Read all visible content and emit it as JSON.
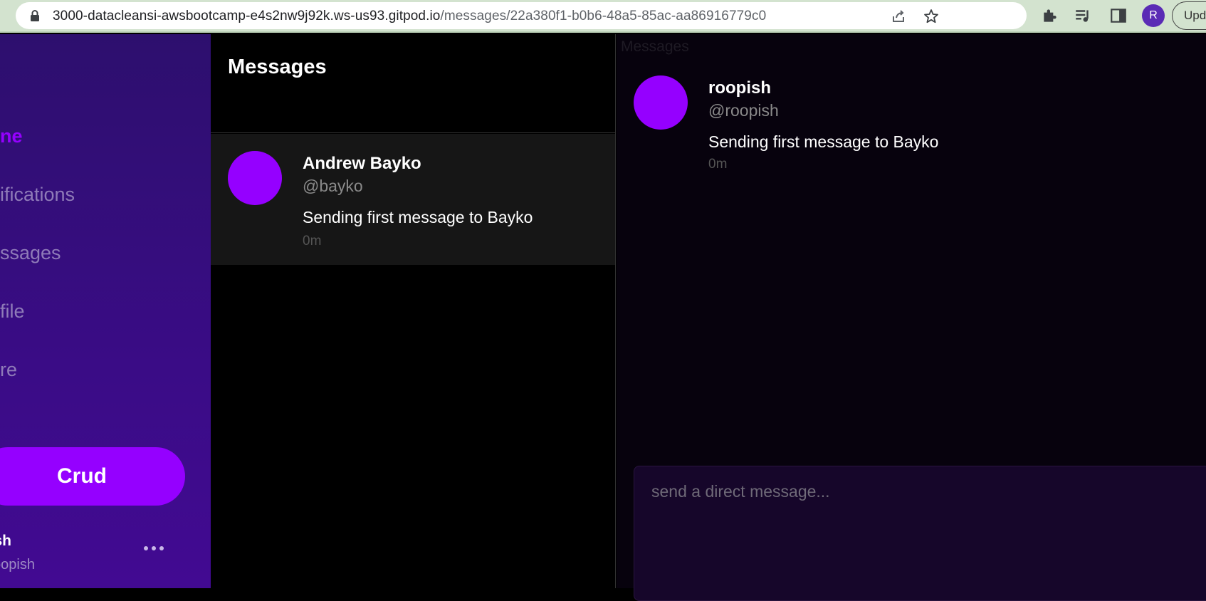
{
  "browser": {
    "url_host": "3000-datacleansi-awsbootcamp-e4s2nw9j92k.ws-us93.gitpod.io",
    "url_path": "/messages/22a380f1-b0b6-48a5-85ac-aa86916779c0",
    "profile_initial": "R",
    "update_label": "Upd"
  },
  "sidebar": {
    "items": [
      {
        "label": "ne",
        "active": true
      },
      {
        "label": "ifications",
        "active": false
      },
      {
        "label": "ssages",
        "active": false
      },
      {
        "label": "file",
        "active": false
      },
      {
        "label": "re",
        "active": false
      }
    ],
    "crud_label": "Crud",
    "user_name": "opish",
    "user_handle": "oopish"
  },
  "groups": {
    "title": "Messages",
    "items": [
      {
        "name": "Andrew Bayko",
        "handle": "@bayko",
        "message": "Sending first message to Bayko",
        "time": "0m"
      }
    ]
  },
  "conversation": {
    "ghost_title": "Messages",
    "messages": [
      {
        "name": "roopish",
        "handle": "@roopish",
        "text": "Sending first message to Bayko",
        "time": "0m"
      }
    ],
    "compose_placeholder": "send a direct message..."
  },
  "colors": {
    "accent": "#9500ff",
    "sidebar_bg": "#3a0c86",
    "conversation_bg": "#07020d"
  }
}
